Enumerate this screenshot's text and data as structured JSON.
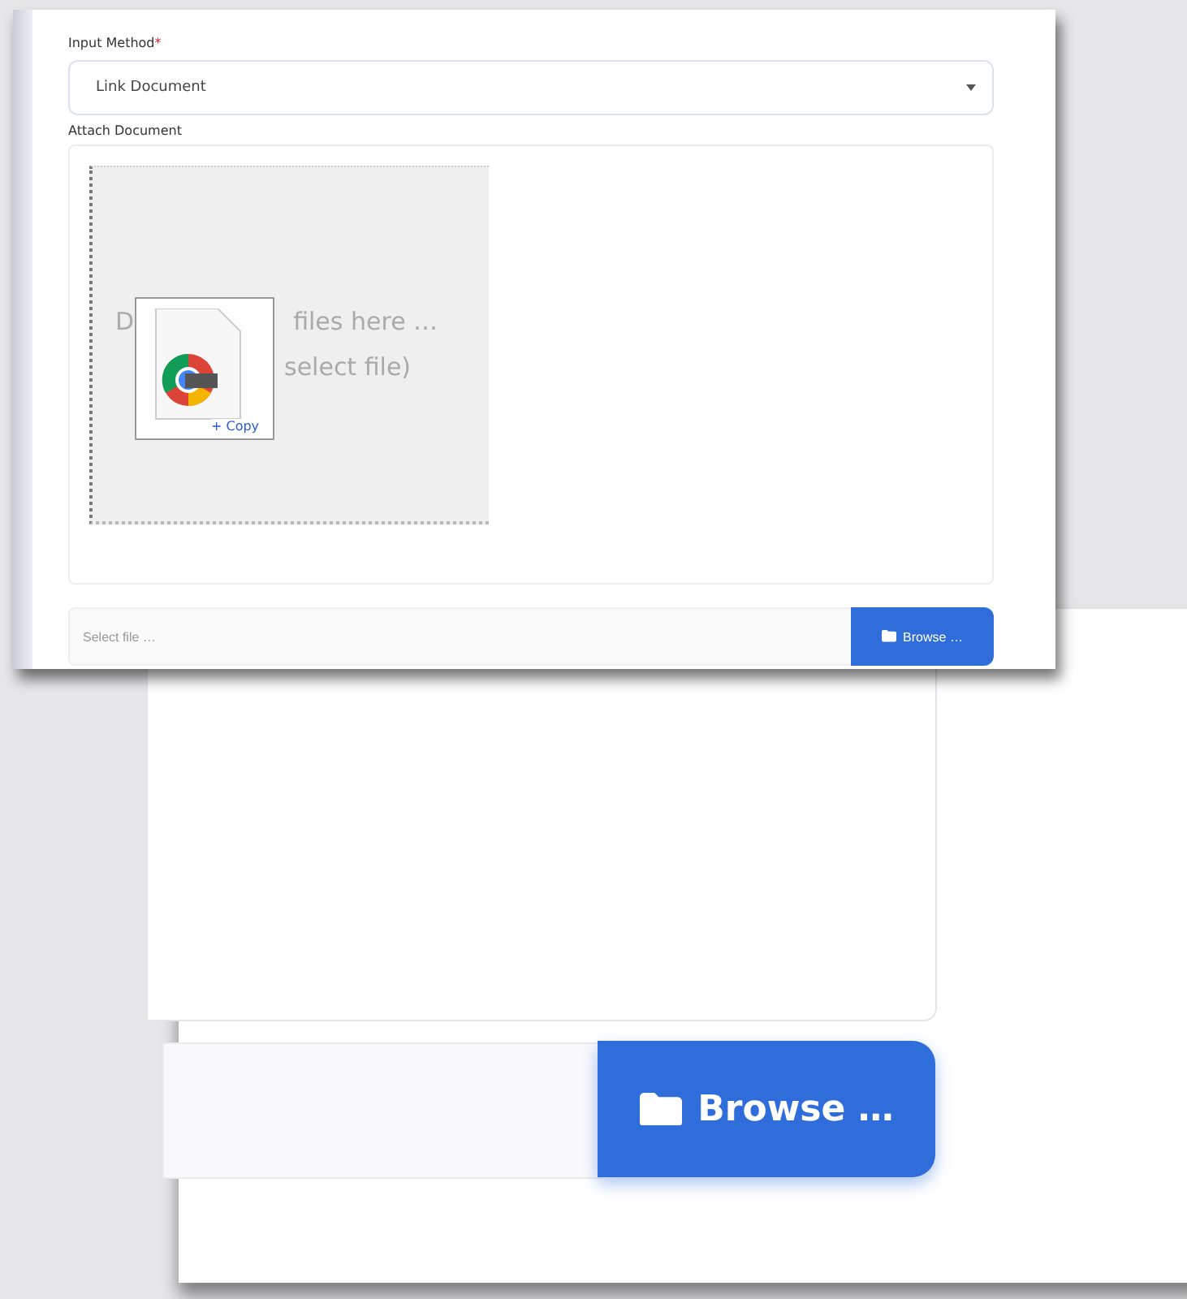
{
  "screenshot": {
    "method_field": {
      "label": "Input Method",
      "required": true,
      "required_mark": "*",
      "value": "Link Document"
    },
    "document_field": {
      "label": "Attach Document"
    },
    "drop_zone": {
      "texts": [
        "D",
        "files here …",
        "select file)"
      ],
      "drag_badge": "+ Copy"
    },
    "file_input": {
      "placeholder": "Select file …",
      "button": "Browse …"
    }
  },
  "zoomed_view": {
    "button": "Browse …"
  }
}
